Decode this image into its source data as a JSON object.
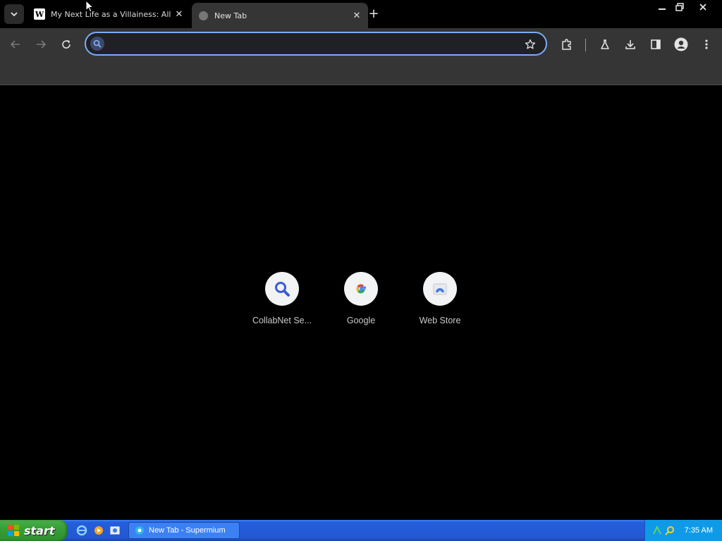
{
  "browser": {
    "tabs": [
      {
        "title": "My Next Life as a Villainess: All Rou",
        "favicon": "wikipedia-icon",
        "active": false
      },
      {
        "title": "New Tab",
        "favicon": "globe-icon",
        "active": true
      }
    ],
    "omnibox": {
      "value": "",
      "placeholder": ""
    }
  },
  "shortcuts": [
    {
      "label": "CollabNet Se...",
      "icon": "search-icon"
    },
    {
      "label": "Google",
      "icon": "google-icon"
    },
    {
      "label": "Web Store",
      "icon": "web-store-icon"
    }
  ],
  "taskbar": {
    "start_label": "start",
    "task_label": "New Tab - Supermium",
    "clock": "7:35 AM"
  },
  "colors": {
    "accent": "#7cacf8",
    "toolbar": "#353535",
    "page_bg": "#000000",
    "taskbar": "#245edb",
    "start_green": "#36a036"
  }
}
